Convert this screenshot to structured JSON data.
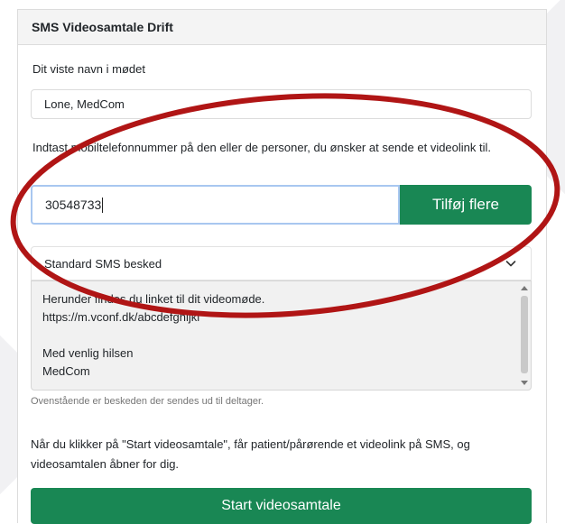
{
  "card": {
    "title": "SMS Videosamtale Drift"
  },
  "form": {
    "name_label": "Dit viste navn i mødet",
    "name_value": "Lone, MedCom",
    "phone_label": "Indtast mobiltelefonnummer på den eller de personer, du ønsker at sende et videolink til.",
    "phone_value": "30548733",
    "add_button": "Tilføj flere",
    "message_select": "Standard SMS besked",
    "message_lines": [
      "Herunder findes du linket til dit videomøde.",
      "https://m.vconf.dk/abcdefghijkl",
      "",
      "Med venlig hilsen",
      "MedCom"
    ],
    "message_help": "Ovenstående er beskeden der sendes ud til deltager.",
    "info_text": "Når du klikker på \"Start videosamtale\", får patient/pårørende et videolink på SMS, og videosamtalen åbner for dig.",
    "start_button": "Start videosamtale"
  },
  "colors": {
    "primary_green": "#198754",
    "annotation_red": "#b01515",
    "focus_border": "#a8c7f0"
  },
  "icons": {
    "select_chevron": "chevron-down-icon"
  }
}
